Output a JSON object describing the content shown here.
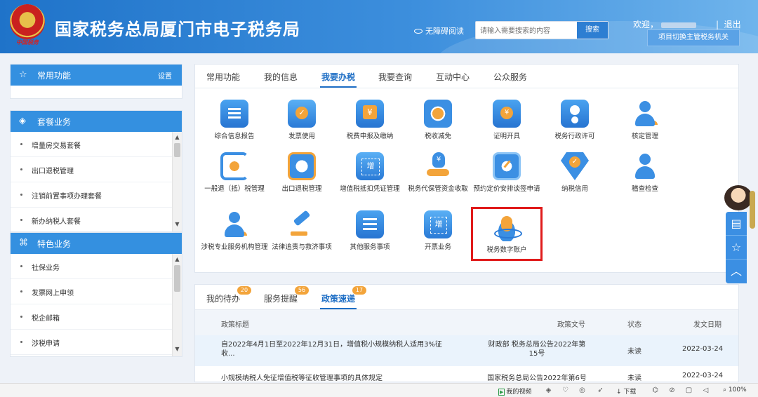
{
  "header": {
    "title": "国家税务总局厦门市电子税务局",
    "emblem_caption": "中国税务",
    "accessibility": "无障碍阅读",
    "search_placeholder": "请输入需要搜索的内容",
    "search_button": "搜索",
    "welcome": "欢迎，",
    "logout": "退出",
    "switch_button": "项目切换主管税务机关"
  },
  "sidebar": {
    "common": {
      "title": "常用功能",
      "settings": "设置"
    },
    "packages": {
      "title": "套餐业务",
      "items": [
        "增量房交易套餐",
        "出口退税管理",
        "注销前置事项办理套餐",
        "新办纳税人套餐"
      ]
    },
    "special": {
      "title": "特色业务",
      "items": [
        "社保业务",
        "发票网上申领",
        "税企邮箱",
        "涉税申请"
      ]
    }
  },
  "main": {
    "tabs": [
      "常用功能",
      "我的信息",
      "我要办税",
      "我要查询",
      "互动中心",
      "公众服务"
    ],
    "active_tab": "我要办税",
    "services": [
      "综合信息报告",
      "发票使用",
      "税费申报及缴纳",
      "税收减免",
      "证明开具",
      "税务行政许可",
      "核定管理",
      "一般退（抵）税管理",
      "出口退税管理",
      "增值税抵扣凭证管理",
      "税务代保管资金收取",
      "预约定价安排谈签申请",
      "纳税信用",
      "稽查检查",
      "涉税专业服务机构管理",
      "法律追责与救济事项",
      "其他服务事项",
      "开票业务",
      "税务数字账户"
    ],
    "highlighted_service": "税务数字账户"
  },
  "policy": {
    "tabs": [
      {
        "label": "我的待办",
        "count": "20"
      },
      {
        "label": "服务提醒",
        "count": "56"
      },
      {
        "label": "政策速递",
        "count": "17"
      }
    ],
    "active_tab": "政策速递",
    "columns": [
      "政策标题",
      "政策文号",
      "状态",
      "发文日期"
    ],
    "rows": [
      {
        "title": "自2022年4月1日至2022年12月31日，增值税小规模纳税人适用3%征收...",
        "doc_no": "财政部 税务总局公告2022年第15号",
        "status": "未读",
        "date": "2022-03-24"
      },
      {
        "title": "小规模纳税人免征增值税等征收管理事项的具体规定",
        "doc_no": "国家税务总局公告2022年第6号",
        "status": "未读",
        "date": "2022-03-24"
      }
    ]
  },
  "statusbar": {
    "video": "我的视频",
    "download": "下载",
    "zoom": "100%"
  },
  "colors": {
    "primary": "#3490e0",
    "accent": "#f3a43a",
    "highlight_border": "#e01b1b"
  }
}
